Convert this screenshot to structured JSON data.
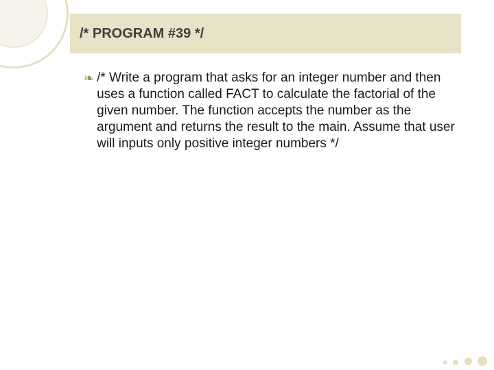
{
  "slide": {
    "title": "/* PROGRAM #39 */",
    "bullet_glyph": "❧",
    "body": "/* Write a program that asks for an integer number and then uses a function called FACT to calculate the factorial of the given number. The function accepts the number as the argument and returns the result to the main. Assume that user will inputs only positive integer numbers */"
  }
}
